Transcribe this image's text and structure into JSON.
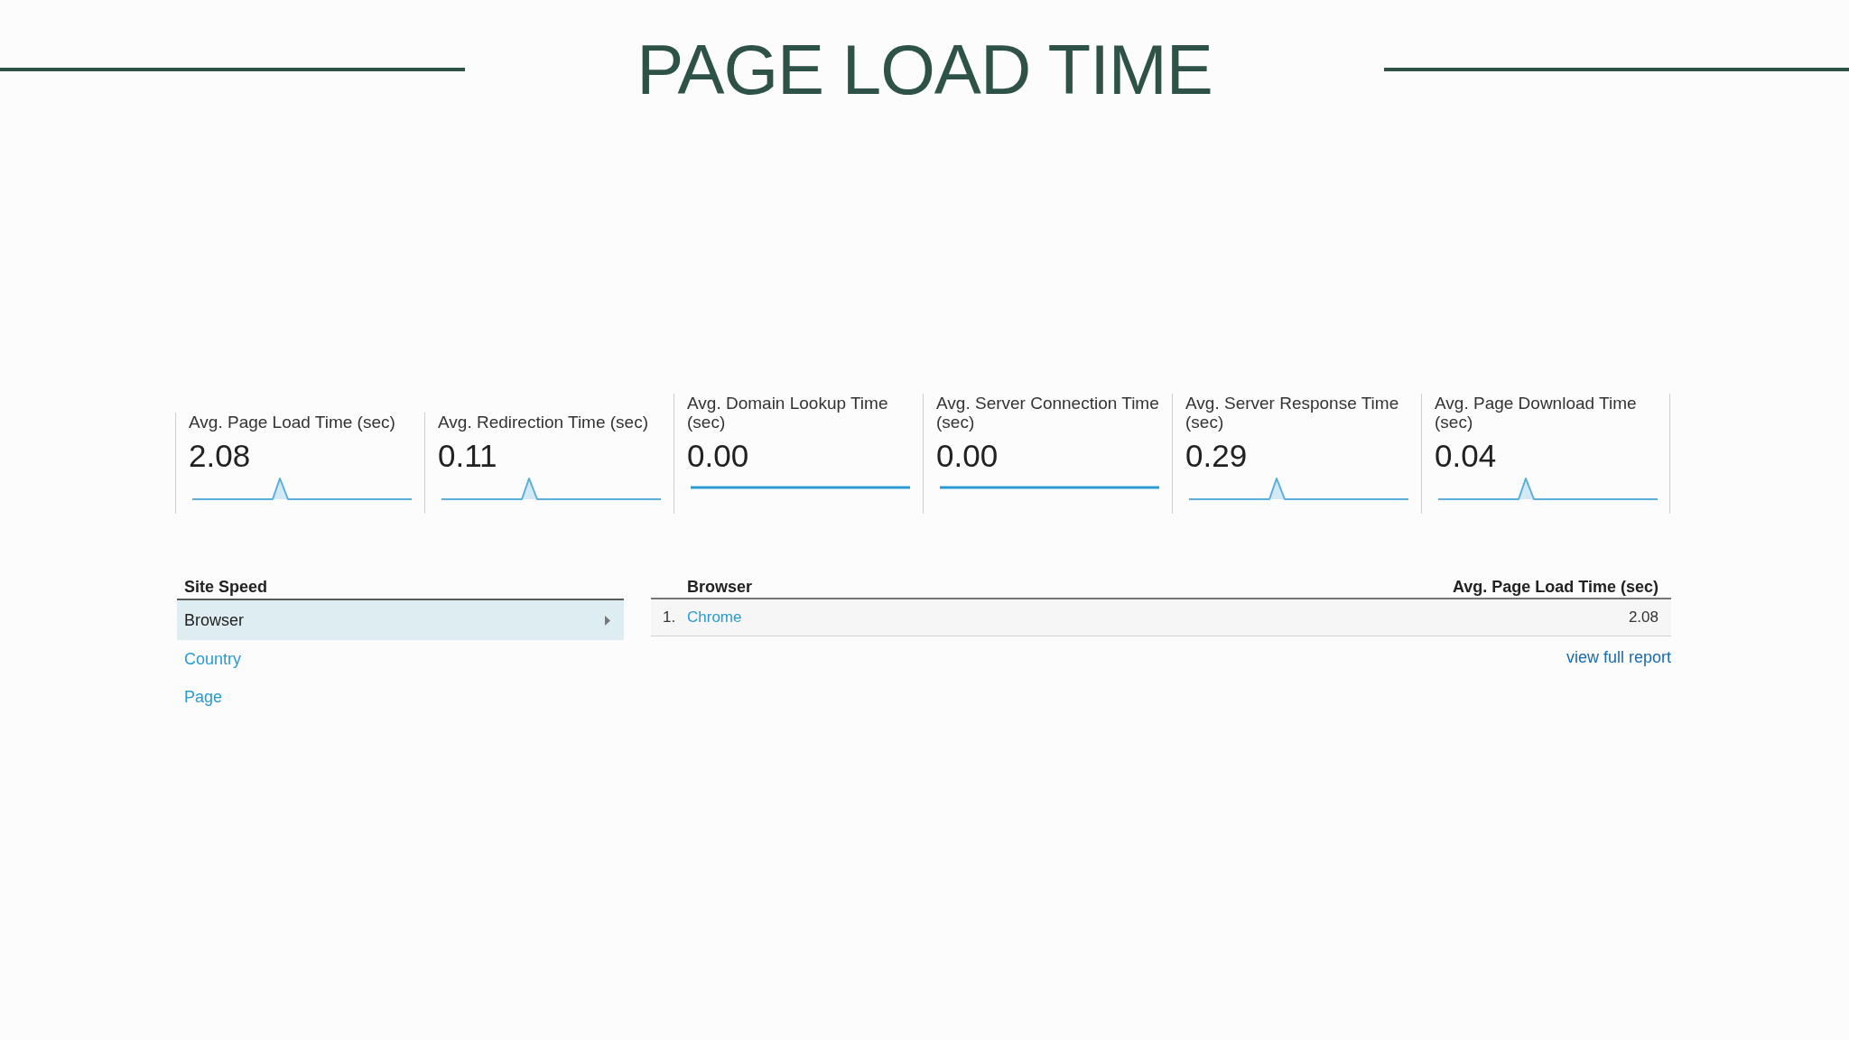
{
  "title": "PAGE LOAD TIME",
  "metrics": [
    {
      "label": "Avg. Page Load Time (sec)",
      "value": "2.08",
      "kind": "spike"
    },
    {
      "label": "Avg. Redirection Time (sec)",
      "value": "0.11",
      "kind": "spike"
    },
    {
      "label": "Avg. Domain Lookup Time (sec)",
      "value": "0.00",
      "kind": "flat"
    },
    {
      "label": "Avg. Server Connection Time (sec)",
      "value": "0.00",
      "kind": "flat"
    },
    {
      "label": "Avg. Server Response Time (sec)",
      "value": "0.29",
      "kind": "spike"
    },
    {
      "label": "Avg. Page Download Time (sec)",
      "value": "0.04",
      "kind": "spike"
    }
  ],
  "site_speed": {
    "heading": "Site Speed",
    "items": [
      {
        "label": "Browser",
        "selected": true
      },
      {
        "label": "Country",
        "selected": false
      },
      {
        "label": "Page",
        "selected": false
      }
    ]
  },
  "table": {
    "columns": [
      "Browser",
      "Avg. Page Load Time (sec)"
    ],
    "rows": [
      {
        "number": "1.",
        "browser": "Chrome",
        "value": "2.08"
      }
    ],
    "footer_link": "view full report"
  }
}
